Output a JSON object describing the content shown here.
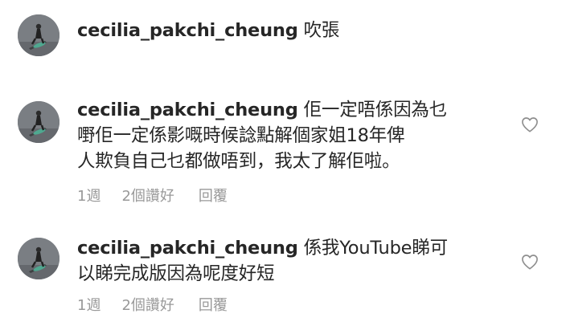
{
  "comments": [
    {
      "username": "cecilia_pakchi_cheung",
      "text": "吹張",
      "line2": "",
      "line3": "",
      "has_meta": false
    },
    {
      "username": "cecilia_pakchi_cheung",
      "text": "佢一定唔係因為乜",
      "line2": "嘢佢一定係影嘅時候諗點解個家姐18年俾",
      "line3": "人欺負自己乜都做唔到，我太了解佢啦。",
      "time": "1週",
      "likes": "2個讚好",
      "reply": "回覆",
      "has_meta": true
    },
    {
      "username": "cecilia_pakchi_cheung",
      "text": "係我YouTube睇可",
      "line2": "以睇完成版因為呢度好短",
      "line3": "",
      "time": "1週",
      "likes": "2個讚好",
      "reply": "回覆",
      "has_meta": true
    }
  ],
  "colors": {
    "text": "#262626",
    "meta": "#999999",
    "heart_outline": "#8e8e8e"
  },
  "icons": {
    "like": "heart-outline-icon",
    "avatar": "profile-avatar"
  }
}
